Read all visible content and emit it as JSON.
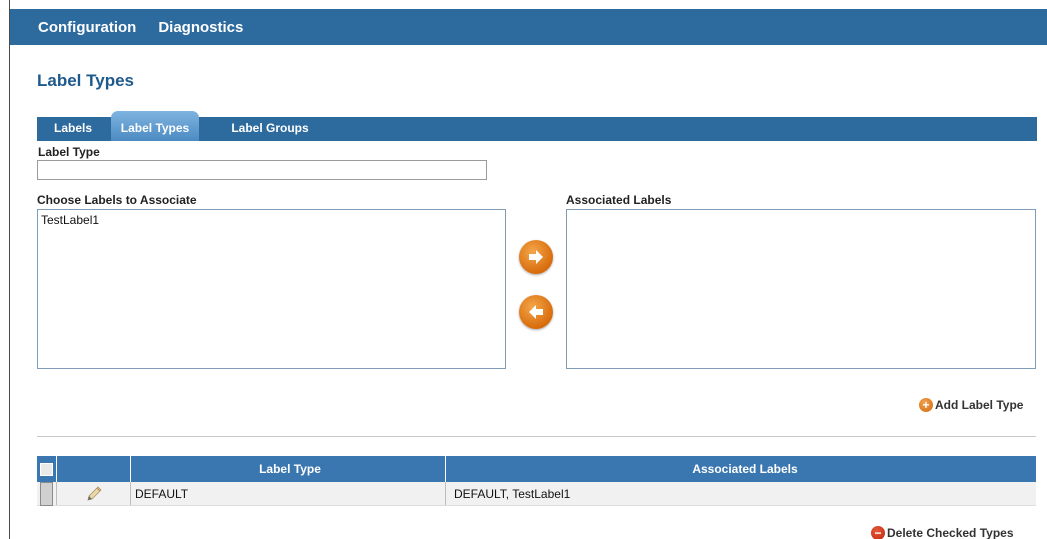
{
  "topnav": {
    "items": [
      "Configuration",
      "Diagnostics"
    ]
  },
  "page": {
    "title": "Label Types"
  },
  "tabs": [
    {
      "label": "Labels"
    },
    {
      "label": "Label Types",
      "active": true
    },
    {
      "label": "Label Groups"
    }
  ],
  "form": {
    "label_type_label": "Label Type",
    "label_type_value": "",
    "choose_label": "Choose Labels to Associate",
    "choose_options": [
      "TestLabel1"
    ],
    "associated_label": "Associated Labels",
    "associated_options": [],
    "add_button": "Add Label Type"
  },
  "table": {
    "columns": [
      "",
      "",
      "Label Type",
      "Associated Labels"
    ],
    "rows": [
      {
        "label_type": "DEFAULT",
        "associated": "DEFAULT, TestLabel1"
      }
    ],
    "delete_button": "Delete Checked Types"
  },
  "icons": {
    "move_right": "arrow-right-icon",
    "move_left": "arrow-left-icon",
    "add": "add-icon",
    "edit": "pencil-icon",
    "delete": "delete-icon"
  },
  "colors": {
    "nav_blue": "#2d6a9e",
    "header_blue": "#3a77b0",
    "title_blue": "#1f5a8c",
    "accent_orange": "#d86d0d"
  }
}
